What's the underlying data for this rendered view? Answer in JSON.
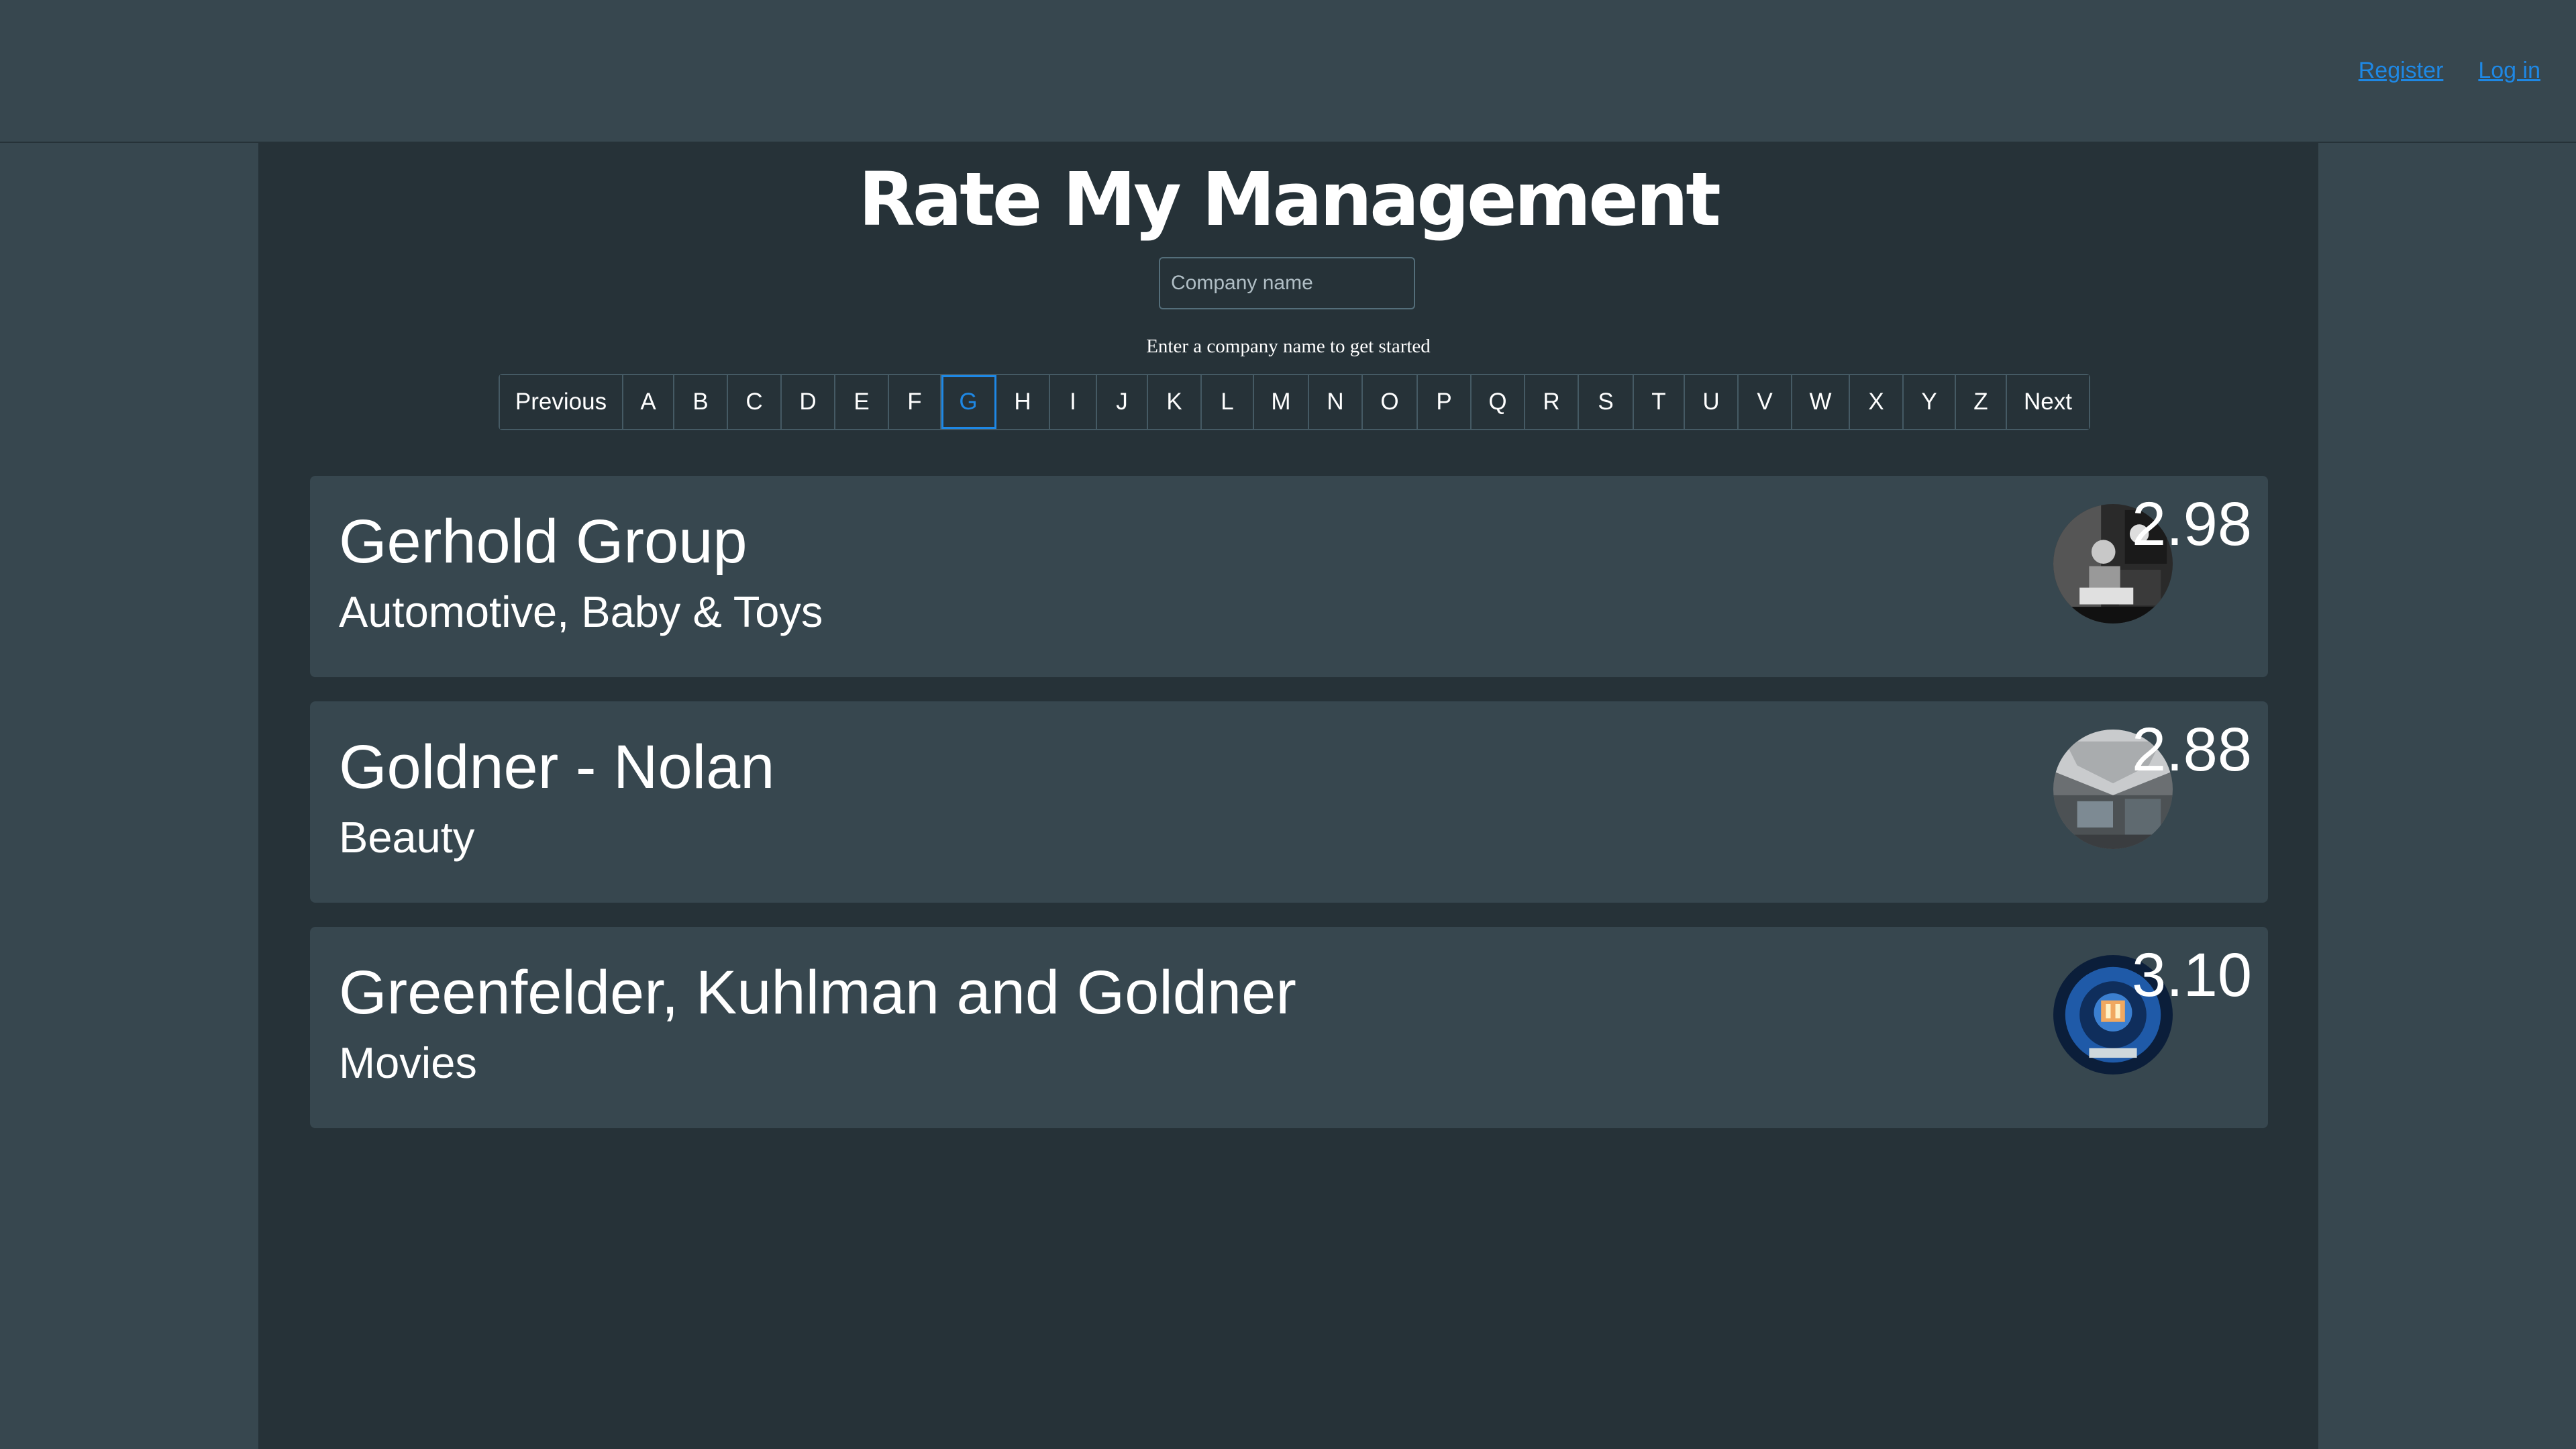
{
  "nav": {
    "register": "Register",
    "login": "Log in"
  },
  "title": "Rate My Management",
  "search": {
    "placeholder": "Company name",
    "value": ""
  },
  "hint": "Enter a company name to get started",
  "pagination": {
    "previous": "Previous",
    "next": "Next",
    "active": "G",
    "letters": [
      "A",
      "B",
      "C",
      "D",
      "E",
      "F",
      "G",
      "H",
      "I",
      "J",
      "K",
      "L",
      "M",
      "N",
      "O",
      "P",
      "Q",
      "R",
      "S",
      "T",
      "U",
      "V",
      "W",
      "X",
      "Y",
      "Z"
    ]
  },
  "companies": [
    {
      "name": "Gerhold Group",
      "categories": "Automotive, Baby & Toys",
      "rating": "2.98",
      "image": "grayscale-person-photo"
    },
    {
      "name": "Goldner - Nolan",
      "categories": "Beauty",
      "rating": "2.88",
      "image": "building-interior-photo"
    },
    {
      "name": "Greenfelder, Kuhlman and Goldner",
      "categories": "Movies",
      "rating": "3.10",
      "image": "blue-tech-photo"
    }
  ],
  "colors": {
    "accent": "#1e88e5",
    "background": "#37474f",
    "panel": "#263238",
    "card": "#37474f"
  }
}
